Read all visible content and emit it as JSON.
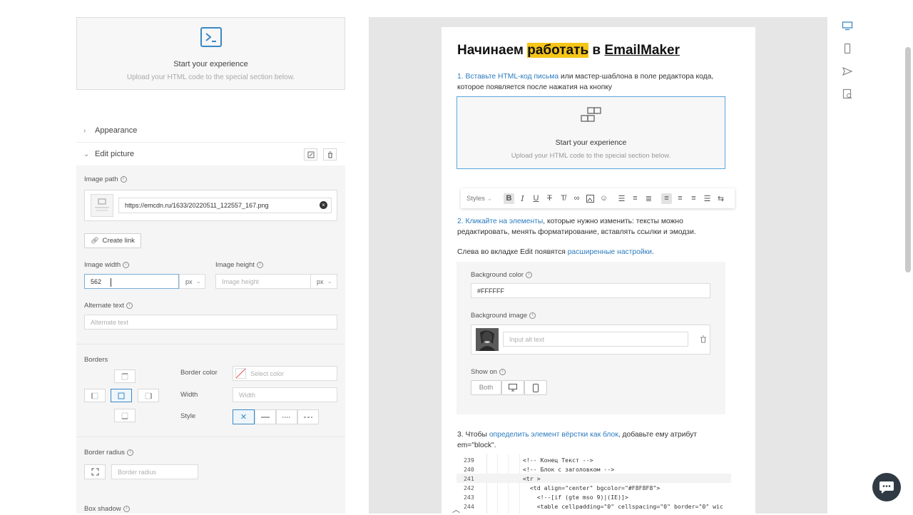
{
  "left": {
    "thumb": {
      "title": "Start your experience",
      "subtitle": "Upload your HTML code to the special section below."
    },
    "appearance_label": "Appearance",
    "edit_picture_label": "Edit picture",
    "image_path_label": "Image path",
    "image_path_value": "https://emcdn.ru/1633/20220511_122557_167.png",
    "create_link_label": "Create link",
    "image_width_label": "Image width",
    "image_width_value": "562",
    "image_width_unit": "px",
    "image_height_label": "Image height",
    "image_height_placeholder": "Image height",
    "image_height_unit": "px",
    "alt_text_label": "Alternate text",
    "alt_text_placeholder": "Alternate text",
    "borders_label": "Borders",
    "border_color_label": "Border color",
    "border_color_placeholder": "Select color",
    "width_label": "Width",
    "width_placeholder": "Width",
    "style_label": "Style",
    "border_radius_label": "Border radius",
    "border_radius_placeholder": "Border radius",
    "box_shadow_label": "Box shadow"
  },
  "email": {
    "h1_a": "Начинаем ",
    "h1_b": "работать",
    "h1_c": " в ",
    "h1_d": "EmailMaker",
    "p1_link": "1. Вставьте HTML-код письма",
    "p1_rest": " или мастер-шаблона в поле редактора кода, которое появляется после нажатия на кнопку",
    "block_title": "Start your experience",
    "block_sub": "Upload your HTML code to the special section below.",
    "toolbar_styles": "Styles",
    "p2_link": "2. Кликайте на элементы",
    "p2_rest": ", которые нужно изменить: тексты можно редактировать, менять форматирование, вставлять ссылки и эмодзи.",
    "p3_a": "Слева во вкладке Edit появятся ",
    "p3_link": "расширенные настройки",
    "p3_c": ".",
    "bg_color_label": "Background color",
    "bg_color_value": "#FFFFFF",
    "bg_image_label": "Background image",
    "bg_image_placeholder": "Input alt text",
    "show_on_label": "Show on",
    "show_on_both": "Both",
    "p4_a": "3. Чтобы ",
    "p4_link": "определить элемент вёрстки как блок",
    "p4_c": ", добавьте ему атрибут em=\"block\".",
    "code_lines": [
      {
        "n": "239",
        "t": "<!-- Конец Текст -->"
      },
      {
        "n": "240",
        "t": "<!-- Блок с заголовком -->"
      },
      {
        "n": "241",
        "t": "<tr >"
      },
      {
        "n": "242",
        "t": "  <td align=\"center\" bgcolor=\"#F8F8F8\">"
      },
      {
        "n": "243",
        "t": "    <!--[if (gte mso 9)|(IE)]>"
      },
      {
        "n": "244",
        "t": "    <table cellpadding=\"0\" cellspacing=\"0\" border=\"0\" wic"
      }
    ]
  },
  "colors": {
    "accent": "#2a7bbf",
    "highlight": "#f5c518",
    "selected_border": "#5aa7dd"
  }
}
